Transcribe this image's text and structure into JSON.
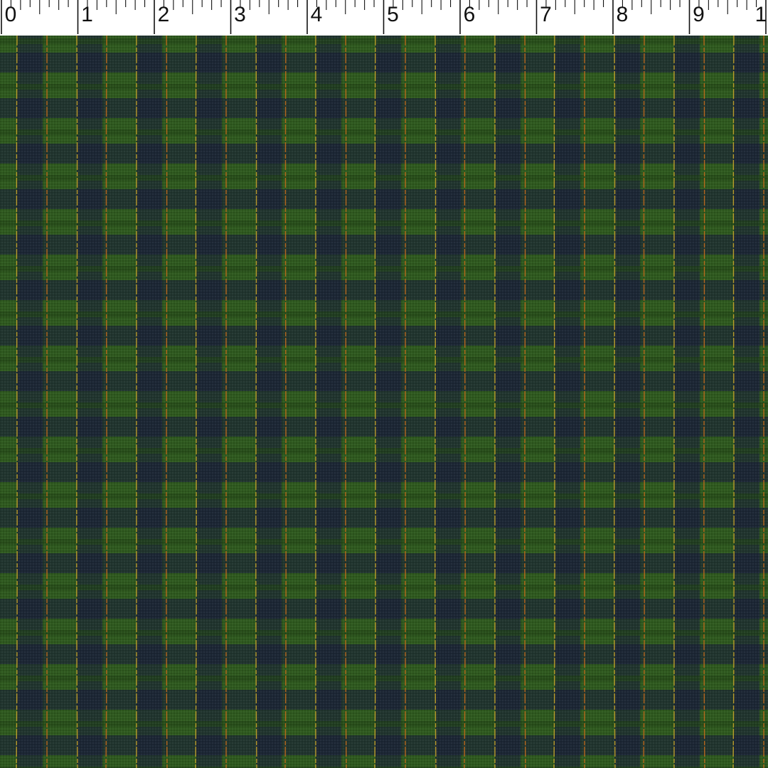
{
  "ruler": {
    "unit_labels": [
      "0",
      "1",
      "2",
      "3",
      "4",
      "5",
      "6",
      "7",
      "8",
      "9",
      "1"
    ],
    "minor_divisions_per_unit": 8
  },
  "fabric": {
    "pattern": "gingham-plaid",
    "colors": {
      "green": "#2f5a1f",
      "green_dark": "#234516",
      "navy": "#1a1f3a",
      "mixed": "#1e3322",
      "metallic_gold": "#c9a52a",
      "metallic_orange": "#c46a1c"
    }
  }
}
